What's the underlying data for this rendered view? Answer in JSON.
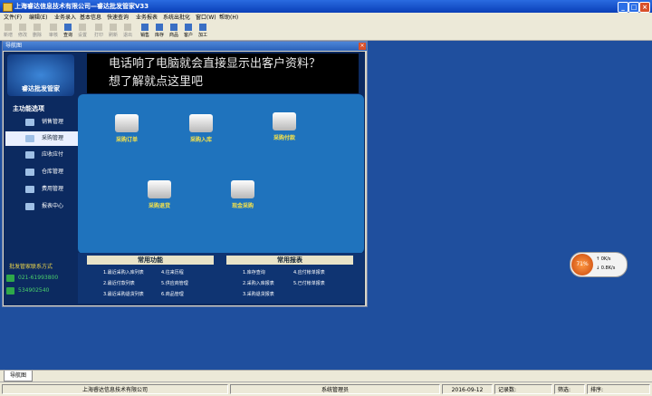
{
  "window": {
    "title": "上海睿达信息技术有限公司—睿达批发管家V33"
  },
  "menu": [
    "文件(F)",
    "编辑(E)",
    "业务录入",
    "基本信息",
    "快速查询",
    "业务报表",
    "系统出批化",
    "窗口(W)",
    "帮助(H)"
  ],
  "toolbar": [
    {
      "label": "新增",
      "enabled": false
    },
    {
      "label": "修改",
      "enabled": false
    },
    {
      "label": "删除",
      "enabled": false
    },
    {
      "label": "审核",
      "enabled": false
    },
    {
      "label": "查询",
      "enabled": true
    },
    {
      "label": "设置",
      "enabled": false
    },
    {
      "label": "打印",
      "enabled": false
    },
    {
      "label": "刷新",
      "enabled": false
    },
    {
      "label": "退出",
      "enabled": false
    },
    {
      "label": "销售",
      "enabled": true
    },
    {
      "label": "库存",
      "enabled": true
    },
    {
      "label": "商品",
      "enabled": true
    },
    {
      "label": "客户",
      "enabled": true
    },
    {
      "label": "加工",
      "enabled": true
    }
  ],
  "nav": {
    "title": "导航图",
    "logo_text": "睿达批发管家",
    "banner_lines": [
      "电话响了电脑就会直接显示出客户资料？",
      "想了解就点这里吧"
    ],
    "main_label": "主功能选项",
    "menu_items": [
      "销售管理",
      "采购管理",
      "应收应付",
      "仓库管理",
      "费用管理",
      "报表中心"
    ],
    "selected_item": "采购管理",
    "functions": [
      "采购订单",
      "采购入库",
      "采购付款",
      "采购退货",
      "现金采购"
    ],
    "common_functions": {
      "title": "常用功能",
      "items": [
        "1.最近采购入库列表",
        "4.往来历程",
        "2.最近付款列表",
        "5.供应商管理",
        "3.最近采购退货列表",
        "6.商品管理"
      ]
    },
    "common_reports": {
      "title": "常用报表",
      "items": [
        "1.库存查询",
        "4.应付帐单报表",
        "2.采购入库报表",
        "5.已付帐单报表",
        "3.采购退货报表"
      ]
    },
    "contact": {
      "title": "批发管家联系方式",
      "phone": "021-61993800",
      "qq": "534902540"
    }
  },
  "gauge": {
    "percent": "71%",
    "rows": [
      "0K/s",
      "0.8K/s"
    ]
  },
  "tabs": [
    "导航图"
  ],
  "status": {
    "company": "上海睿达信息技术有限公司",
    "user": "系统管理员",
    "date": "2016-09-12",
    "records_label": "记录数:",
    "filter_label": "筛选:",
    "sort_label": "排序:"
  },
  "colors": {
    "accent": "#1f73bd",
    "background": "#1f4f9e",
    "banner_bg": "#000000",
    "highlight": "#f6e24a"
  }
}
